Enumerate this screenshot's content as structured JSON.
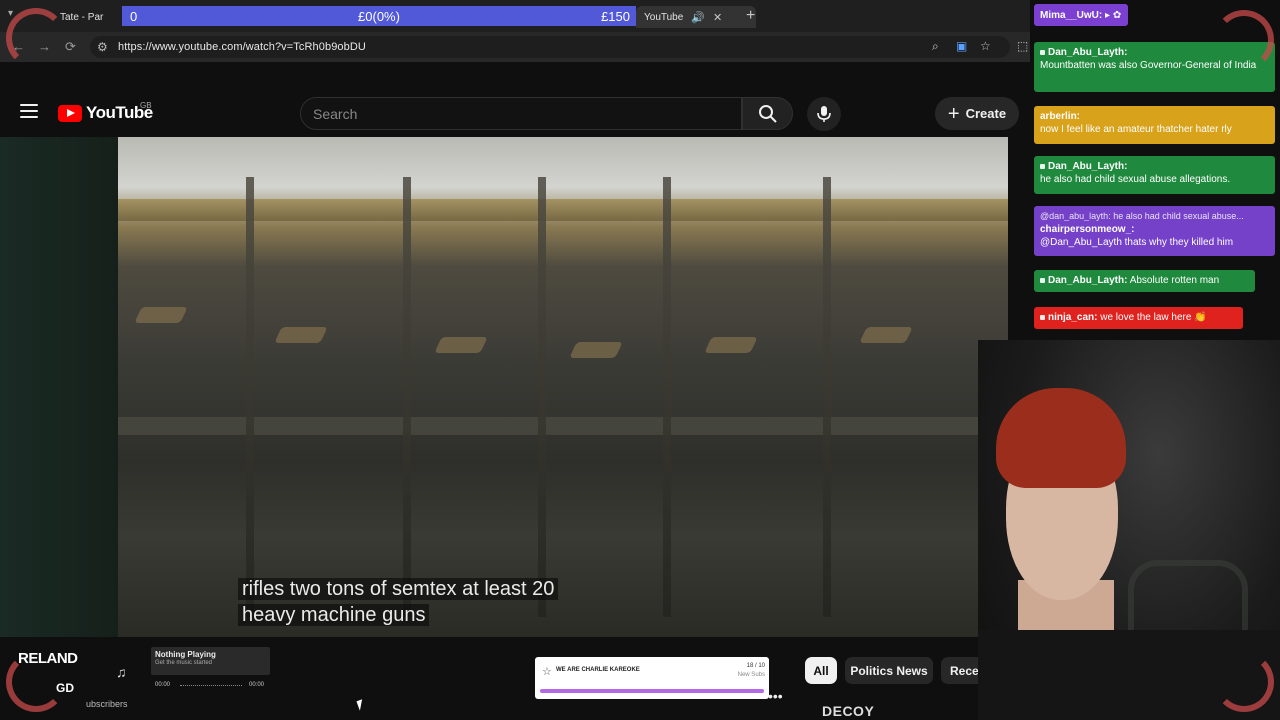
{
  "browser": {
    "tab_left_title": "Tate - Par",
    "tab_active_title": "YouTube",
    "tab_close": "✕",
    "tab_audio": "🔊",
    "new_tab": "+",
    "url": "https://www.youtube.com/watch?v=TcRh0b9obDU",
    "back": "←",
    "forward": "→",
    "reload": "⟳"
  },
  "goal": {
    "left": "0",
    "middle": "£0(0%)",
    "right": "£150",
    "progress": 0
  },
  "youtube": {
    "logo_text": "YouTube",
    "region": "GB",
    "search_placeholder": "Search",
    "create_label": "Create",
    "create_plus": "+"
  },
  "video": {
    "subtitle_line1": "rifles two tons of semtex at least 20",
    "subtitle_line2": "heavy machine guns"
  },
  "chat": [
    {
      "user": "Mima__UwU:",
      "text": "",
      "color": "#7b3fd1"
    },
    {
      "user": "Dan_Abu_Layth:",
      "text": "Mountbatten was also Governor-General of India",
      "color": "#1f8a3e"
    },
    {
      "user": "arberlin:",
      "text": "now I feel like an amateur thatcher hater rly",
      "color": "#d8a21a"
    },
    {
      "user": "Dan_Abu_Layth:",
      "text": "he also had child sexual abuse allegations.",
      "color": "#1f8a3e"
    },
    {
      "reply": "@dan_abu_layth: he also had child sexual abuse...",
      "user": "chairpersonmeow_:",
      "text": "@Dan_Abu_Layth thats why they killed him",
      "color": "#7541c9"
    },
    {
      "user": "Dan_Abu_Layth:",
      "text": "Absolute rotten man",
      "color": "#1f8a3e"
    },
    {
      "user": "ninja_can:",
      "text": "we love the law here 👏",
      "color": "#e0221e"
    }
  ],
  "bottom": {
    "ireland": "RELAND",
    "gd": "GD",
    "subscribers": "ubscribers",
    "music_title": "Nothing Playing",
    "music_sub": "Get the music started",
    "music_time_left": "00:00",
    "music_time_right": "00:00",
    "sub_goal_title": "WE ARE CHARLIE KAREOKE",
    "sub_goal_count": "18 / 10",
    "sub_goal_label": "New Subs",
    "sub_goal_progress": 1.0,
    "filters": [
      "All",
      "Politics News",
      "Rece"
    ],
    "decoy": "DECOY"
  },
  "icons": {
    "menu": "menu-icon",
    "search": "search-icon",
    "mic": "mic-icon",
    "music": "music-note-icon"
  }
}
